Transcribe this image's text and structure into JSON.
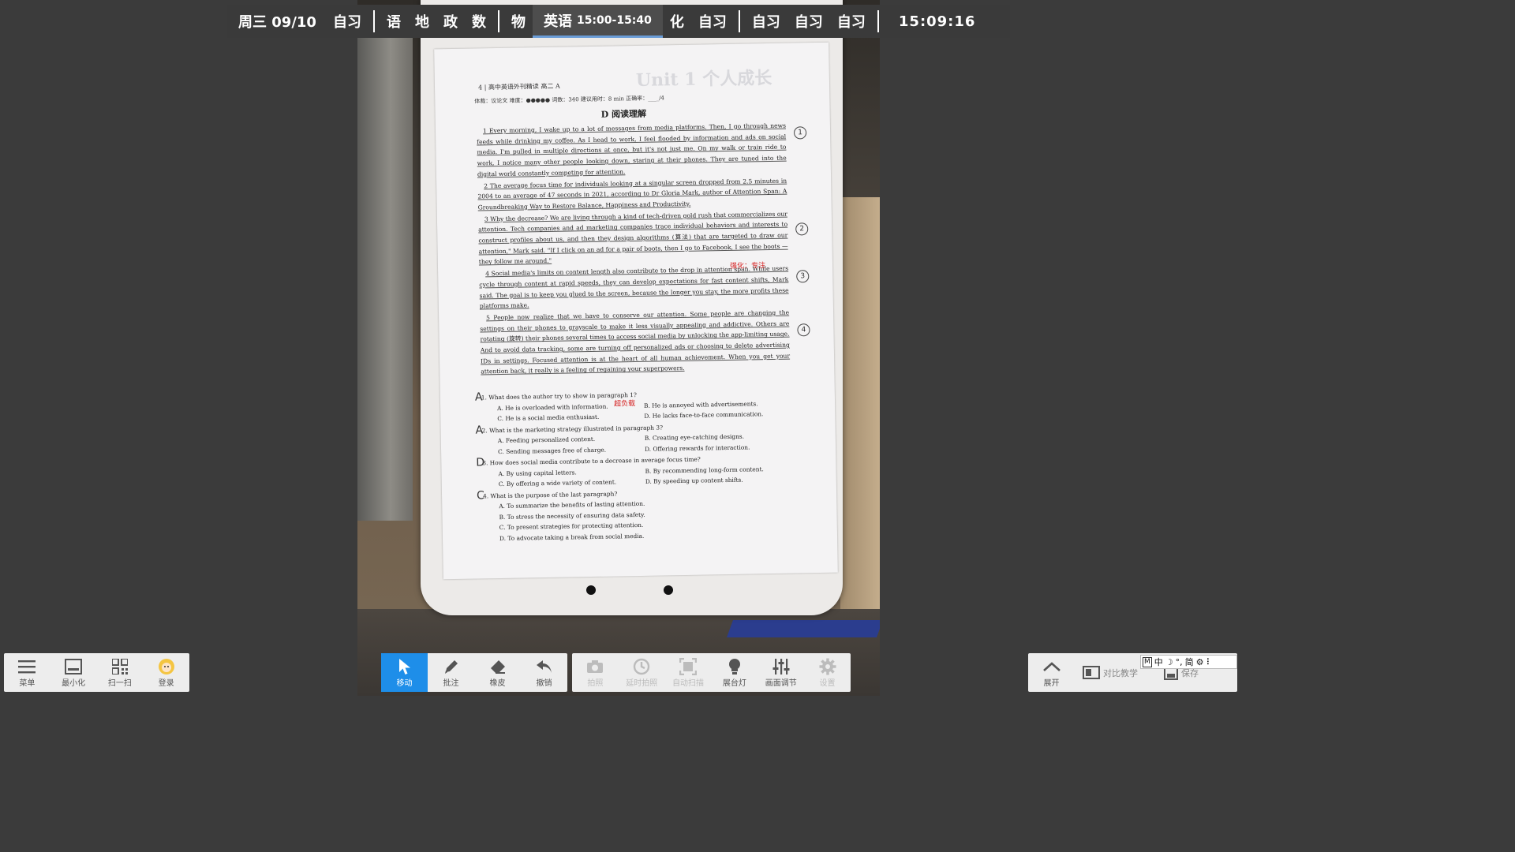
{
  "schedule": {
    "date": "周三 09/10",
    "periods_before": [
      "自习"
    ],
    "group1": [
      "语",
      "地",
      "政",
      "数"
    ],
    "group2_before": [
      "物"
    ],
    "current_subject": "英语",
    "current_time": "15:00-15:40",
    "group2_after": [
      "化",
      "自习"
    ],
    "group3": [
      "自习",
      "自习",
      "自习"
    ],
    "clock": "15:09:16",
    "accent": "#6a9cd6"
  },
  "worksheet": {
    "header_line": "4 | 高中英语外刊精读 高二 A",
    "meta_line": "体裁：议论文  难度：●●●●●  词数：340  建议用时：8 min  正确率：____/4",
    "section_title": "D 阅读理解",
    "ghost_heading": "Unit 1 个人成长",
    "paragraphs": [
      "1  Every morning, I wake up to a lot of messages from media platforms. Then, I go through news feeds while drinking my coffee. As I head to work, I feel flooded by information and ads on social media. I'm pulled in multiple directions at once, but it's not just me. On my walk or train ride to work, I notice many other people looking down, staring at their phones. They are tuned into the digital world constantly competing for attention.",
      "2  The average focus time for individuals looking at a singular screen dropped from 2.5 minutes in 2004 to an average of 47 seconds in 2021, according to Dr Gloria Mark, author of Attention Span: A Groundbreaking Way to Restore Balance, Happiness and Productivity.",
      "3  Why the decrease? We are living through a kind of tech-driven gold rush that commercializes our attention. Tech companies and ad marketing companies trace individual behaviors and interests to construct profiles about us, and then they design algorithms (算法) that are targeted to draw our attention,\" Mark said. \"If I click on an ad for a pair of boots, then I go to Facebook, I see the boots — they follow me around.\"",
      "4  Social media's limits on content length also contribute to the drop in attention span. While users cycle through content at rapid speeds, they can develop expectations for fast content shifts, Mark said. The goal is to keep you glued to the screen, because the longer you stay, the more profits these platforms make.",
      "5  People now realize that we have to conserve our attention. Some people are changing the settings on their phones to grayscale to make it less visually appealing and addictive. Others are rotating (旋转) their phones several times to access social media by unlocking the app-limiting usage. And to avoid data tracking, some are turning off personalized ads or choosing to delete advertising IDs in settings. Focused attention is at the heart of all human achievement. When you get your attention back, it really is a feeling of regaining your superpowers."
    ],
    "questions": [
      {
        "mark": "A",
        "stem": "1. What does the author try to show in paragraph 1?",
        "options": [
          "A. He is overloaded with information.",
          "B. He is annoyed with advertisements.",
          "C. He is a social media enthusiast.",
          "D. He lacks face-to-face communication."
        ]
      },
      {
        "mark": "A",
        "stem": "2. What is the marketing strategy illustrated in paragraph 3?",
        "options": [
          "A. Feeding personalized content.",
          "B. Creating eye-catching designs.",
          "C. Sending messages free of charge.",
          "D. Offering rewards for interaction."
        ]
      },
      {
        "mark": "D",
        "stem": "3. How does social media contribute to a decrease in average focus time?",
        "options": [
          "A. By using capital letters.",
          "B. By recommending long-form content.",
          "C. By offering a wide variety of content.",
          "D. By speeding up content shifts."
        ]
      },
      {
        "mark": "C",
        "stem": "4. What is the purpose of the last paragraph?",
        "options": [
          "A. To summarize the benefits of lasting attention.",
          "B. To stress the necessity of ensuring data safety.",
          "C. To present strategies for protecting attention.",
          "D. To advocate taking a break from social media."
        ]
      }
    ],
    "para_numbers": [
      "1",
      "2",
      "3",
      "4"
    ],
    "red_notes": [
      "强化：专注",
      "超负载"
    ]
  },
  "toolbar_left": {
    "menu": "菜单",
    "minimize": "最小化",
    "scan": "扫一扫",
    "login": "登录"
  },
  "toolbar_mid": {
    "move": "移动",
    "annotate": "批注",
    "eraser": "橡皮",
    "undo": "撤销"
  },
  "toolbar_camera": {
    "photo": "拍照",
    "timer_photo": "延时拍照",
    "auto_scan": "自动扫描",
    "light": "展台灯",
    "adjust": "画面调节",
    "settings": "设置"
  },
  "toolbar_right": {
    "expand": "展开",
    "compare": "对比教学",
    "save": "保存"
  },
  "ime": {
    "mode": "M",
    "lang": "中",
    "simplified": "简"
  },
  "colors": {
    "active_tool": "#1e8ee9",
    "toolbar_bg": "#ededed",
    "background": "#3b3b3b"
  }
}
